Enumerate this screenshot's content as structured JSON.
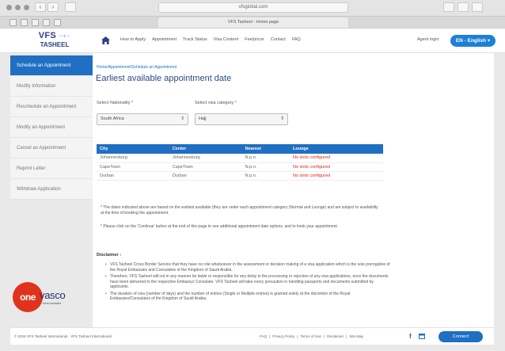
{
  "browser": {
    "address": "vfsglobal.com",
    "tab_title": "VFS Tasheel - Home page",
    "nav_back": "‹",
    "nav_fwd": "›"
  },
  "header": {
    "logo_top": "VFS",
    "logo_mark": "~+~",
    "logo_bottom": "TASHEEL",
    "nav": [
      "How to Apply",
      "Appointment",
      "Track Status",
      "Visa Content",
      "Fee/pricer",
      "Contact",
      "FAQ"
    ],
    "agent_login": "Agent login",
    "language": "EN - English"
  },
  "sidebar": {
    "items": [
      {
        "label": "Schedule an Appointment",
        "active": true
      },
      {
        "label": "Modify Information",
        "active": false
      },
      {
        "label": "Reschedule an Appointment",
        "active": false
      },
      {
        "label": "Modify an Appointment",
        "active": false
      },
      {
        "label": "Cancel an Appointment",
        "active": false
      },
      {
        "label": "Reprint Letter",
        "active": false
      },
      {
        "label": "Withdraw Application",
        "active": false
      }
    ]
  },
  "main": {
    "breadcrumb": "Home/Appointment/Schedule an Appointment",
    "title": "Earliest available appointment date",
    "nationality_label": "Select Nationality *",
    "nationality_value": "South Africa",
    "category_label": "Select visa category *",
    "category_value": "Hajj",
    "table": {
      "headers": [
        "City",
        "Center",
        "Nearest",
        "Lounge"
      ],
      "rows": [
        [
          "Johannesburg",
          "Johannesburg",
          "N.p.n.",
          "No slots configured"
        ],
        [
          "CapeTown",
          "CapeTown",
          "N.p.n.",
          "No slots configured"
        ],
        [
          "Durban",
          "Durban",
          "N.p.n.",
          "No slots configured"
        ]
      ]
    },
    "note1": "* The dates indicated above are based on the earliest available (they are under each appointment category (Normal and Lounge) and are subject to availability at the time of booking the appointment.",
    "note2": "* Please click on the 'Continue' button at the end of this page to see additional appointment date options, and to book your appointment.",
    "disclaimer_title": "Disclaimer :",
    "disclaimer_items": [
      "VFS Tasheel Cross Border Service that they have no role whatsoever in the assessment or decision making of a visa application which is the sole prerogative of the Royal Embassies and Consulates of the Kingdom of Saudi Arabia.",
      "Therefore, VFS Tasheel will not in any manner be liable or responsible for any delay in the processing or rejection of any visa applications, once the documents have been delivered to the respective Embassy/ Consulate. VFS Tasheel will take every precaution in handling passports and documents submitted by applicants.",
      "The duration of visa (number of days) and the number of entries (Single or Multiple entries) is granted solely at the discretion of the Royal Embassies/Consulates of the Kingdom of Saudi Arabia."
    ]
  },
  "footer": {
    "copyright": "© 2018 VFS Tasheel International - VFS Tasheel International",
    "links": [
      "FAQ",
      "Privacy Policy",
      "Terms of Use",
      "Disclaimer",
      "Site Map"
    ],
    "connect": "Connect"
  },
  "watermark": {
    "circle": "one",
    "text": "vasco",
    "tag": "travel assistant"
  },
  "colors": {
    "primary": "#1f6fc2",
    "status_red": "#e2231a",
    "title_blue": "#2b4b83",
    "watermark_red": "#e0331e"
  }
}
